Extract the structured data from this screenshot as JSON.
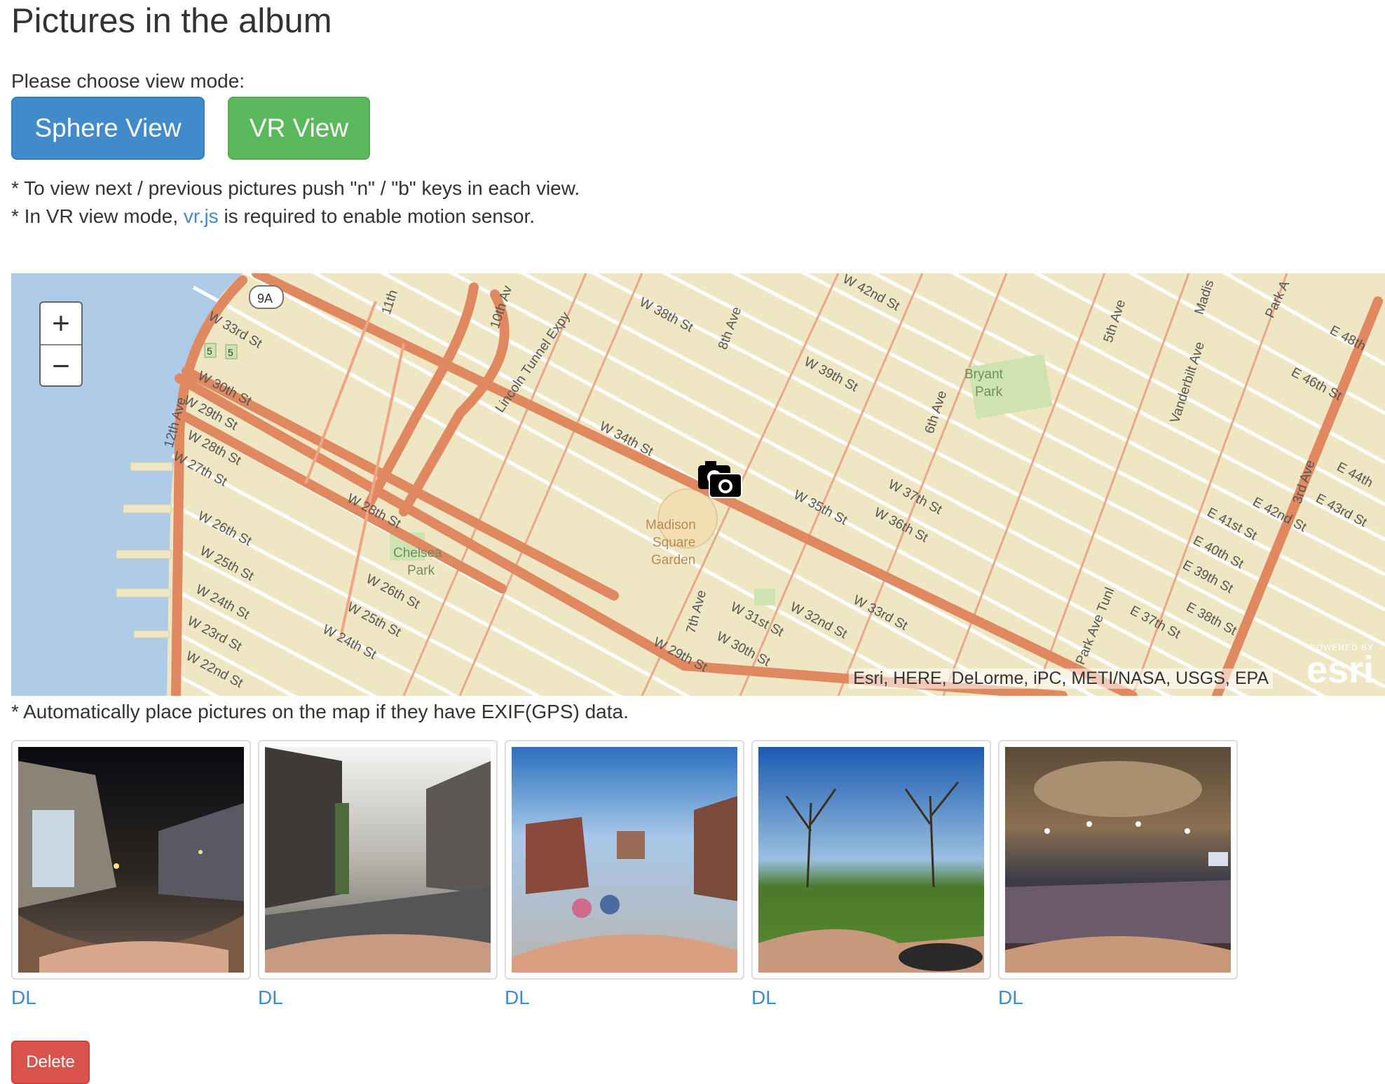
{
  "page": {
    "title": "Pictures in the album"
  },
  "view_mode": {
    "label": "Please choose view mode:",
    "sphere_button": "Sphere View",
    "vr_button": "VR View"
  },
  "notes": {
    "note1": "* To view next / previous pictures push \"n\" / \"b\" keys in each view.",
    "note2_prefix": "* In VR view mode,",
    "note2_link": "vr.js",
    "note2_suffix": "is required to enable motion sensor.",
    "note3": "* Automatically place pictures on the map if they have EXIF(GPS) data."
  },
  "map": {
    "zoom_in": "+",
    "zoom_out": "−",
    "attribution": "Esri, HERE, DeLorme, iPC, METI/NASA, USGS, EPA",
    "logo_powered": "POWERED BY",
    "logo_name": "esri",
    "labels": {
      "shield": "9A",
      "exit": "5",
      "w33": "W 33rd St",
      "w30": "W 30th St",
      "w29": "W 29th St",
      "w28": "W 28th St",
      "w27": "W 27th St",
      "w26": "W 26th St",
      "w25": "W 25th St",
      "w24": "W 24th St",
      "w23": "W 23rd St",
      "w22": "W 22nd St",
      "ave12": "12th Ave",
      "ave11": "11th",
      "ave10": "10th Av",
      "lincoln": "Lincoln Tunnel Expy",
      "w38": "W 38th St",
      "ave8": "8th Ave",
      "w34": "W 34th St",
      "w28b": "W 28th St",
      "w26b": "W 26th St",
      "w25b": "W 25th St",
      "w24b": "W 24th St",
      "chelsea": "Chelsea",
      "chelsea2": "Park",
      "msg1": "Madison",
      "msg2": "Square",
      "msg3": "Garden",
      "ave7": "7th Ave",
      "w31": "W 31st St",
      "w30b": "W 30th St",
      "w29b": "W 29th St",
      "w32": "W 32nd St",
      "w33b": "W 33rd St",
      "w35": "W 35th St",
      "w36": "W 36th St",
      "w37": "W 37th St",
      "w39": "W 39th St",
      "w42": "W 42nd St",
      "bryant1": "Bryant",
      "bryant2": "Park",
      "ave6": "6th Ave",
      "ave5": "5th Ave",
      "madison": "Madis",
      "vanderbilt": "Vanderbilt Ave",
      "parkave": "Park A",
      "tunnel": "Park Ave Tunl",
      "e37": "E 37th St",
      "e38": "E 38th St",
      "e39": "E 39th St",
      "e40": "E 40th St",
      "e41": "E 41st St",
      "e42": "E 42nd St",
      "e43": "E 43rd St",
      "e44": "E 44th",
      "e46": "E 46th St",
      "e48": "E 48th",
      "ave3": "3rd Ave"
    }
  },
  "photos": [
    {
      "dl": "DL"
    },
    {
      "dl": "DL"
    },
    {
      "dl": "DL"
    },
    {
      "dl": "DL"
    },
    {
      "dl": "DL"
    }
  ],
  "actions": {
    "delete": "Delete"
  },
  "colors": {
    "primary": "#428bca",
    "success": "#5cb85c",
    "danger": "#d9534f",
    "road": "#e08860",
    "water": "#aecbe8",
    "land": "#efe6c4"
  }
}
